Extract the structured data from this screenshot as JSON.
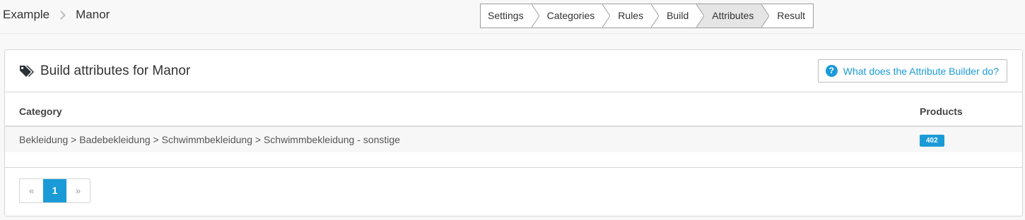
{
  "breadcrumb": {
    "root": "Example",
    "current": "Manor"
  },
  "wizard": {
    "steps": [
      "Settings",
      "Categories",
      "Rules",
      "Build",
      "Attributes",
      "Result"
    ],
    "active": "Attributes"
  },
  "panel": {
    "title": "Build attributes for Manor",
    "title_icon": "tags-icon",
    "help_button": "What does the Attribute Builder do?",
    "help_icon": "question-circle-icon"
  },
  "table": {
    "columns": [
      "Category",
      "Products"
    ],
    "rows": [
      {
        "category": "Bekleidung > Badebekleidung > Schwimmbekleidung > Schwimmbekleidung - sonstige",
        "products": "402"
      }
    ]
  },
  "pagination": {
    "prev": "«",
    "current": "1",
    "next": "»"
  },
  "colors": {
    "accent": "#1a9bd7",
    "active_step": "#e5e5e5"
  }
}
